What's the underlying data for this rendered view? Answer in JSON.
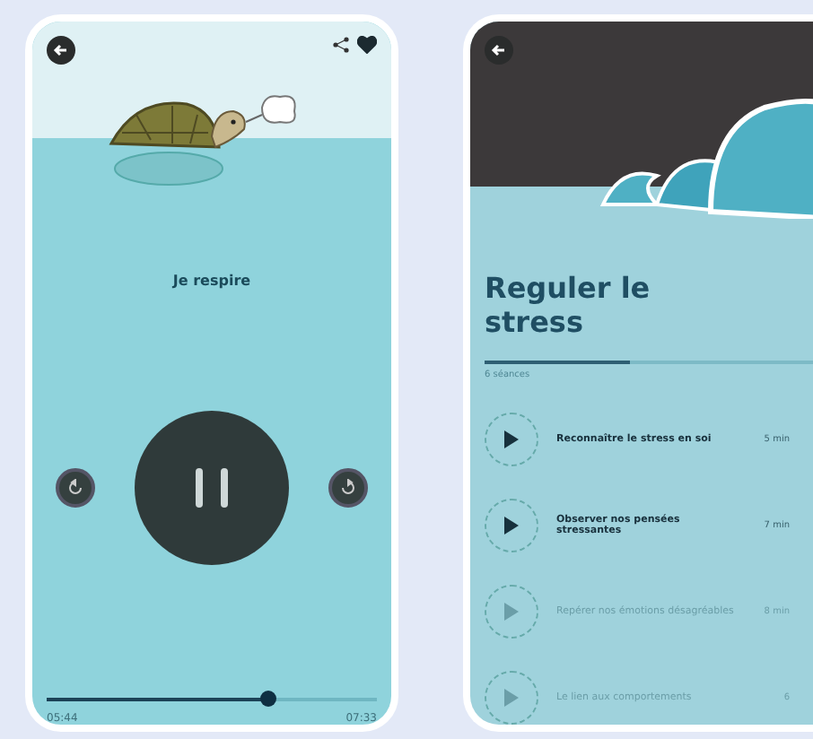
{
  "player": {
    "title": "Je respire",
    "favorite": true,
    "progress": {
      "level": 0.67
    },
    "elapsed": "05:44",
    "total": "07:33"
  },
  "program": {
    "title": "Reguler le stress",
    "progress": {
      "level": 0.42
    },
    "subtitle": "6 séances",
    "sessions": [
      {
        "title": "Reconnaître le stress en soi",
        "duration": "5 min",
        "disabled": false
      },
      {
        "title": "Observer nos pensées stressantes",
        "duration": "7 min",
        "disabled": false
      },
      {
        "title": "Repérer nos émotions désagréables",
        "duration": "8 min",
        "disabled": true
      },
      {
        "title": "Le lien aux comportements",
        "duration": "6",
        "disabled": true
      }
    ]
  }
}
